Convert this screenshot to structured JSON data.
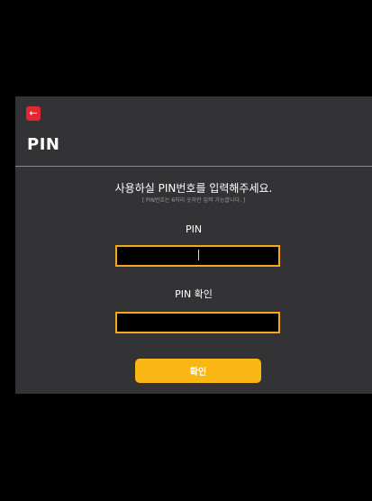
{
  "header": {
    "back_icon": "arrow-left-icon",
    "back_glyph": "←",
    "title": "PIN"
  },
  "form": {
    "instruction": "사용하실 PIN번호를 입력해주세요.",
    "instruction_sub": "[ PIN번호는 6자리 숫자만 입력 가능합니다. ]",
    "pin_label": "PIN",
    "pin_value": "",
    "pin_confirm_label": "PIN 확인",
    "pin_confirm_value": "",
    "confirm_button": "확인"
  },
  "colors": {
    "background": "#000000",
    "panel": "#333335",
    "accent_red": "#e0282e",
    "input_border": "#f5a81c",
    "button": "#f9b614"
  }
}
